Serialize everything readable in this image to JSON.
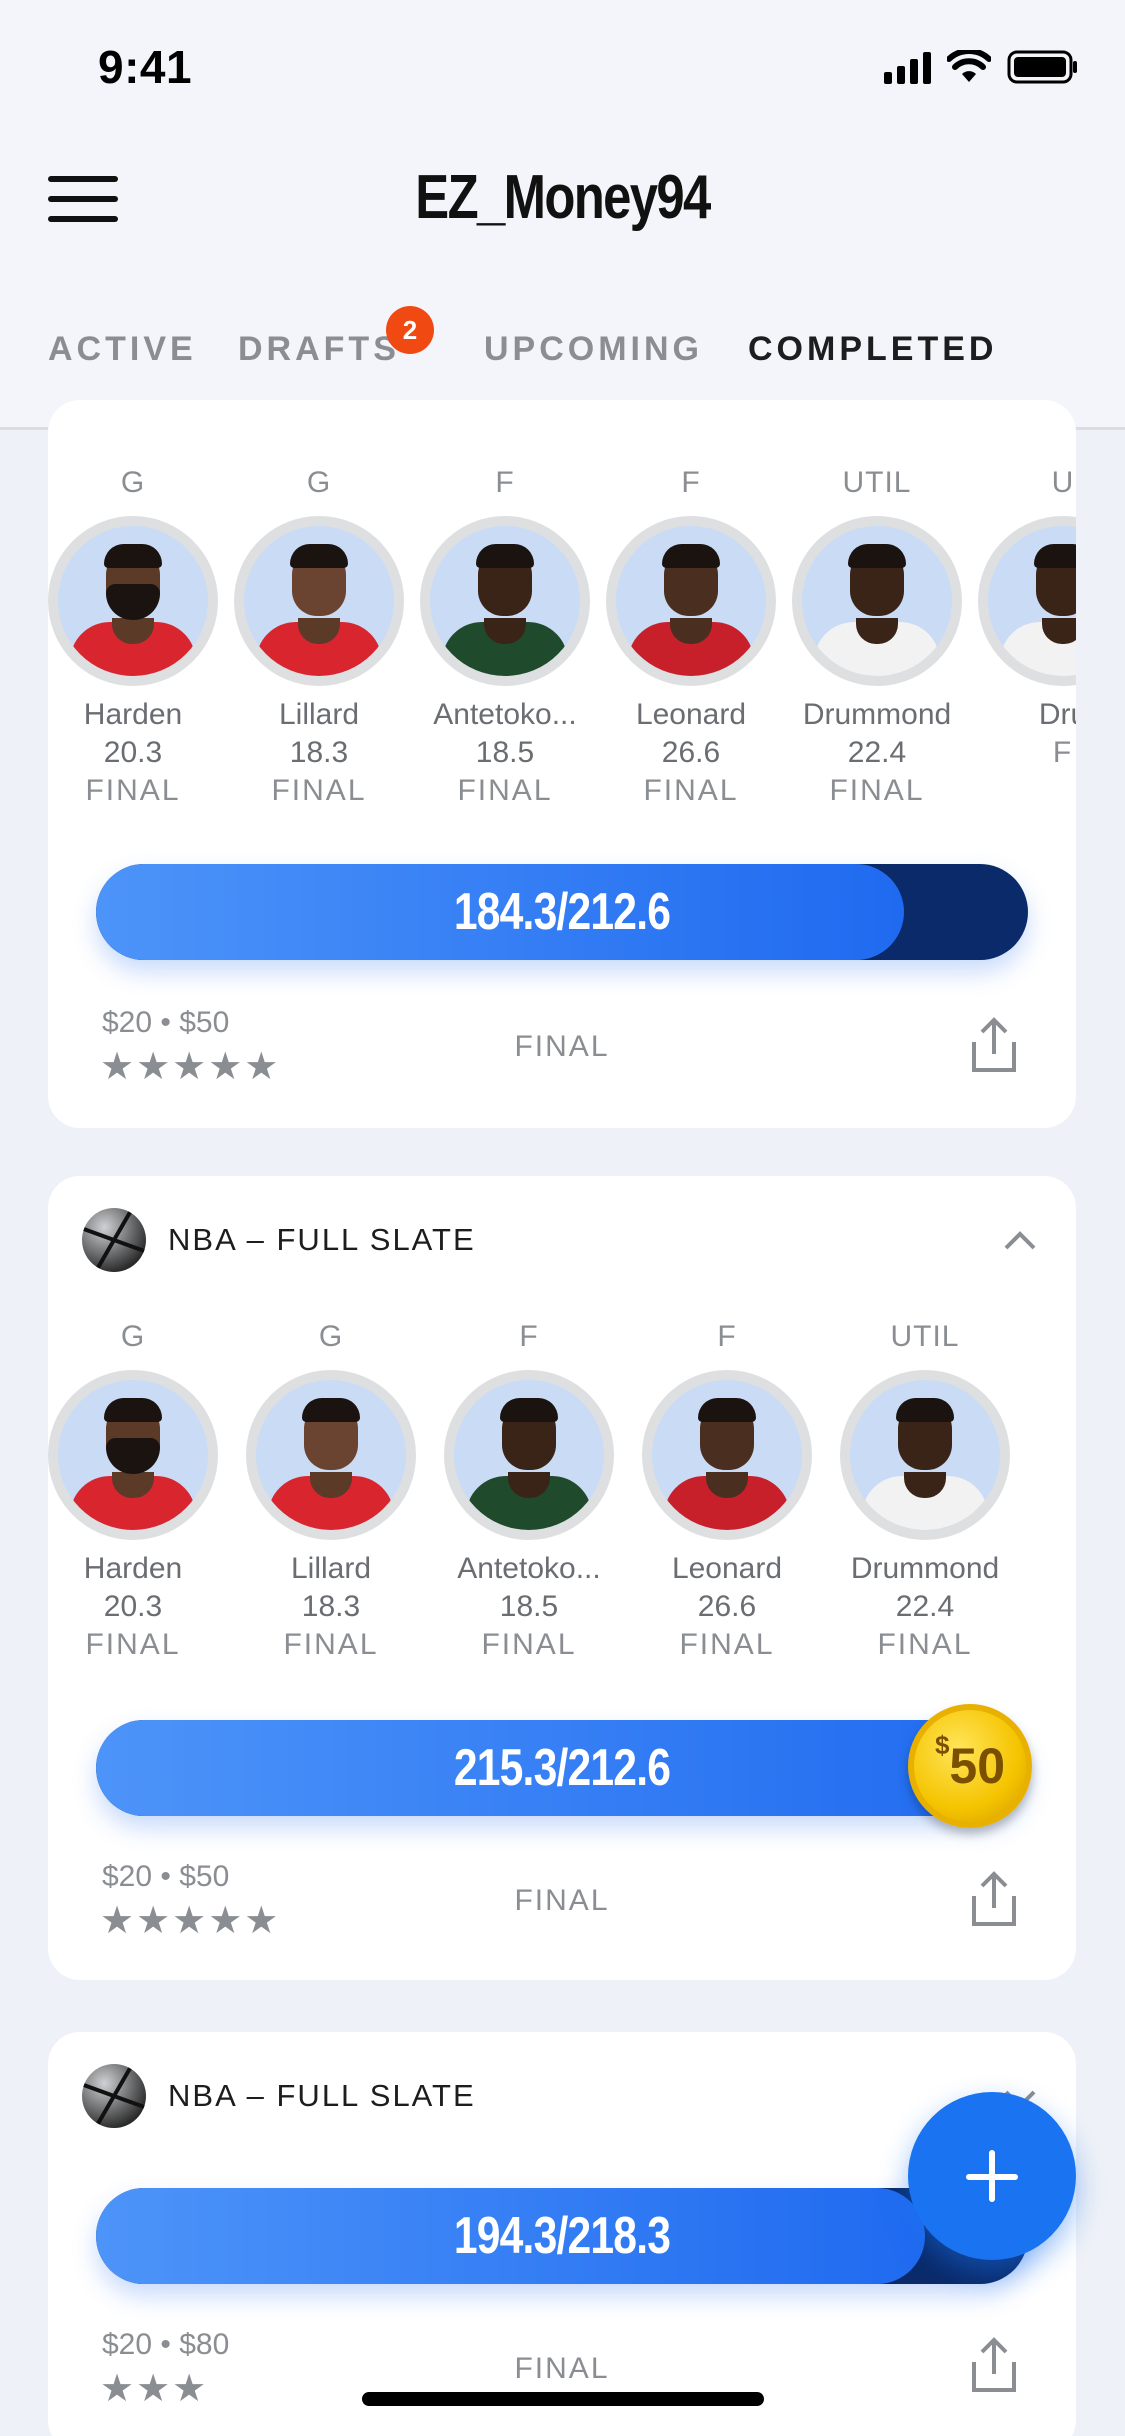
{
  "status_bar": {
    "time": "9:41"
  },
  "header": {
    "title": "EZ_Money94"
  },
  "tabs": [
    {
      "label": "ACTIVE",
      "active": false
    },
    {
      "label": "DRAFTS",
      "active": false,
      "badge": "2"
    },
    {
      "label": "UPCOMING",
      "active": false
    },
    {
      "label": "COMPLETED",
      "active": true
    }
  ],
  "cards": [
    {
      "players": [
        {
          "pos": "G",
          "name": "Harden",
          "score": "20.3",
          "status": "FINAL"
        },
        {
          "pos": "G",
          "name": "Lillard",
          "score": "18.3",
          "status": "FINAL"
        },
        {
          "pos": "F",
          "name": "Antetoko...",
          "score": "18.5",
          "status": "FINAL"
        },
        {
          "pos": "F",
          "name": "Leonard",
          "score": "26.6",
          "status": "FINAL"
        },
        {
          "pos": "UTIL",
          "name": "Drummond",
          "score": "22.4",
          "status": "FINAL"
        },
        {
          "pos": "U",
          "name": "Dru",
          "score": "",
          "status": "F"
        }
      ],
      "progress": {
        "label": "184.3/212.6",
        "fill_pct": 86.7
      },
      "entry": "$20 • $50",
      "stars": "★★★★★",
      "status": "FINAL"
    },
    {
      "slate": "NBA – FULL SLATE",
      "players": [
        {
          "pos": "G",
          "name": "Harden",
          "score": "20.3",
          "status": "FINAL"
        },
        {
          "pos": "G",
          "name": "Lillard",
          "score": "18.3",
          "status": "FINAL"
        },
        {
          "pos": "F",
          "name": "Antetoko...",
          "score": "18.5",
          "status": "FINAL"
        },
        {
          "pos": "F",
          "name": "Leonard",
          "score": "26.6",
          "status": "FINAL"
        },
        {
          "pos": "UTIL",
          "name": "Drummond",
          "score": "22.4",
          "status": "FINAL"
        }
      ],
      "progress": {
        "label": "215.3/212.6",
        "fill_pct": 100
      },
      "prize": {
        "symbol": "$",
        "amount": "50"
      },
      "entry": "$20 • $50",
      "stars": "★★★★★",
      "status": "FINAL"
    },
    {
      "slate": "NBA – FULL SLATE",
      "progress": {
        "label": "194.3/218.3",
        "fill_pct": 89
      },
      "entry": "$20 • $80",
      "stars": "★★★",
      "status": "FINAL"
    }
  ],
  "icons": {
    "menu": "menu-icon",
    "chevron_up": "chevron-up-icon",
    "chevron_down": "chevron-down-icon",
    "share": "share-icon",
    "plus": "plus-icon",
    "basketball": "basketball-icon"
  },
  "colors": {
    "accent": "#1a73f0",
    "badge": "#f04a12",
    "progress_track": "#0a2a6a",
    "coin": "#f5c400"
  }
}
